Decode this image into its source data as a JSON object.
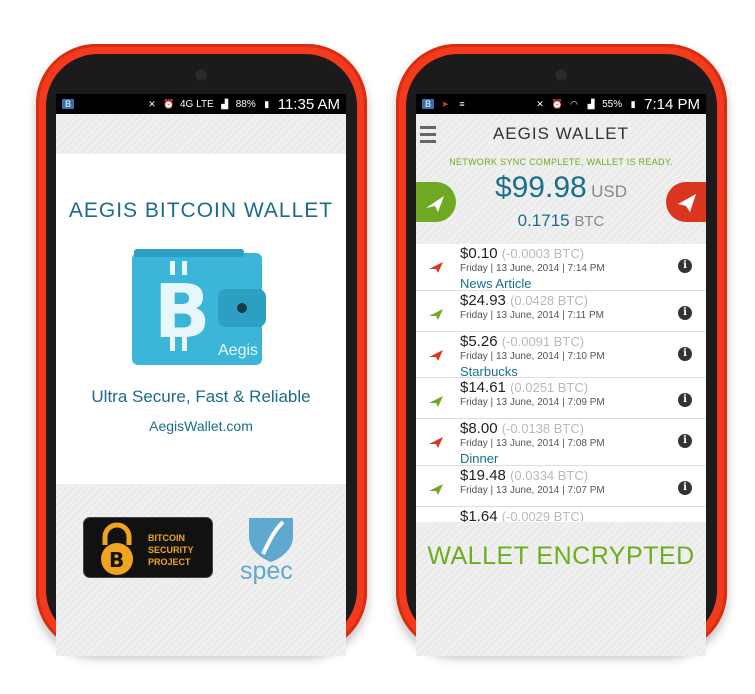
{
  "colors": {
    "phone_shell": "#f33a1c",
    "accent_blue": "#1a6f8f",
    "accent_green": "#6cae1f",
    "send_red": "#d9351f",
    "receive_green": "#6fa823"
  },
  "left_phone": {
    "status": {
      "time": "11:35 AM",
      "battery": "88%",
      "network": "4G LTE"
    },
    "title": "AEGIS BITCOIN WALLET",
    "wallet_logo_text": "Aegis",
    "tagline": "Ultra Secure, Fast & Reliable",
    "url": "AegisWallet.com",
    "badge_lines": [
      "BITCOIN",
      "SECURITY",
      "PROJECT"
    ],
    "spec_logo": "spec"
  },
  "right_phone": {
    "status": {
      "time": "7:14 PM",
      "battery": "55%"
    },
    "title": "AEGIS WALLET",
    "sync_message": "NETWORK SYNC COMPLETE, WALLET IS READY.",
    "balance_usd": "$99.98",
    "balance_usd_unit": "USD",
    "balance_btc": "0.1715",
    "balance_btc_unit": "BTC",
    "transactions": [
      {
        "direction": "sent",
        "amount": "$0.10",
        "btc": "(-0.0003 BTC)",
        "date": "Friday | 13 June, 2014 | 7:14 PM",
        "label": "News Article"
      },
      {
        "direction": "received",
        "amount": "$24.93",
        "btc": "(0.0428 BTC)",
        "date": "Friday | 13 June, 2014 | 7:11 PM",
        "label": ""
      },
      {
        "direction": "sent",
        "amount": "$5.26",
        "btc": "(-0.0091 BTC)",
        "date": "Friday | 13 June, 2014 | 7:10 PM",
        "label": "Starbucks"
      },
      {
        "direction": "received",
        "amount": "$14.61",
        "btc": "(0.0251 BTC)",
        "date": "Friday | 13 June, 2014 | 7:09 PM",
        "label": ""
      },
      {
        "direction": "sent",
        "amount": "$8.00",
        "btc": "(-0.0138 BTC)",
        "date": "Friday | 13 June, 2014 | 7:08 PM",
        "label": "Dinner"
      },
      {
        "direction": "received",
        "amount": "$19.48",
        "btc": "(0.0334 BTC)",
        "date": "Friday | 13 June, 2014 | 7:07 PM",
        "label": ""
      },
      {
        "direction": "sent",
        "amount": "$1.64",
        "btc": "(-0.0029 BTC)",
        "date": "",
        "label": ""
      }
    ],
    "footer": "WALLET ENCRYPTED"
  }
}
